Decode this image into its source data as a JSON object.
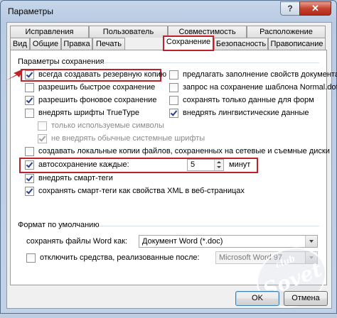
{
  "window": {
    "title": "Параметры",
    "help_glyph": "?",
    "close_glyph": "✕"
  },
  "tabs_row1": [
    {
      "label": "Исправления"
    },
    {
      "label": "Пользователь"
    },
    {
      "label": "Совместимость"
    },
    {
      "label": "Расположение"
    }
  ],
  "tabs_row2": [
    {
      "label": "Вид"
    },
    {
      "label": "Общие"
    },
    {
      "label": "Правка"
    },
    {
      "label": "Печать"
    },
    {
      "label": "Сохранение",
      "active": true
    },
    {
      "label": "Безопасность"
    },
    {
      "label": "Правописание"
    }
  ],
  "save_params": {
    "title": "Параметры сохранения",
    "left": [
      {
        "label": "всегда создавать резервную копию",
        "checked": true
      },
      {
        "label": "разрешить быстрое сохранение",
        "checked": false
      },
      {
        "label": "разрешить фоновое сохранение",
        "checked": true
      },
      {
        "label": "внедрять шрифты TrueType",
        "checked": false
      }
    ],
    "right": [
      {
        "label": "предлагать заполнение свойств документа",
        "checked": false
      },
      {
        "label": "запрос на сохранение шаблона Normal.dot",
        "checked": false
      },
      {
        "label": "сохранять только данные для форм",
        "checked": false
      },
      {
        "label": "внедрять лингвистические данные",
        "checked": true
      }
    ],
    "sub": [
      {
        "label": "только используемые символы",
        "checked": false
      },
      {
        "label": "не внедрять обычные системные шрифты",
        "checked": true
      }
    ],
    "local_copies": {
      "label": "создавать локальные копии файлов, сохраненных на сетевые и съемные диски",
      "checked": false
    },
    "autosave": {
      "label": "автосохранение каждые:",
      "checked": true,
      "value": "5",
      "unit": "минут"
    },
    "smart_tags": {
      "label": "внедрять смарт-теги",
      "checked": true
    },
    "smart_tags_xml": {
      "label": "сохранять смарт-теги как свойства XML в веб-страницах",
      "checked": true
    }
  },
  "default_format": {
    "title": "Формат по умолчанию",
    "save_as_label": "сохранять файлы Word как:",
    "save_as_value": "Документ Word (*.doc)",
    "disable_features": {
      "label": "отключить средства, реализованные после:",
      "checked": false
    },
    "version_value": "Microsoft Word 97"
  },
  "watermark": {
    "top": "club",
    "main": "Sovet"
  },
  "buttons": {
    "ok": "OK",
    "cancel": "Отмена"
  },
  "colors": {
    "highlight": "#c0202a",
    "window_frame": "#bfcde0",
    "close_button": "#c7422e"
  }
}
